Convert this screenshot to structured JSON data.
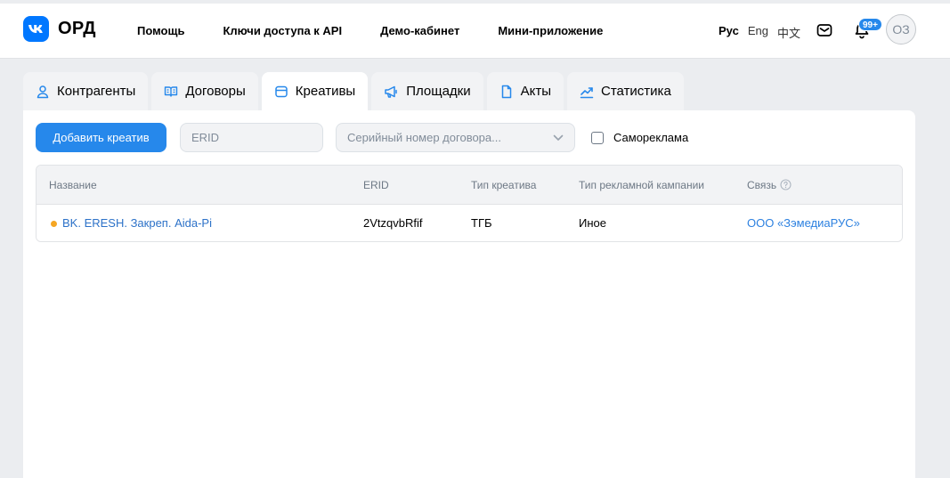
{
  "header": {
    "brand": "ОРД",
    "nav": [
      "Помощь",
      "Ключи доступа к API",
      "Демо-кабинет",
      "Мини-приложение"
    ],
    "languages": [
      "Рус",
      "Eng",
      "中文"
    ],
    "notification_badge": "99+",
    "avatar_initials": "ОЗ"
  },
  "tabs": [
    {
      "label": "Контрагенты",
      "icon": "user-icon"
    },
    {
      "label": "Договоры",
      "icon": "book-icon"
    },
    {
      "label": "Креативы",
      "icon": "creative-card-icon"
    },
    {
      "label": "Площадки",
      "icon": "megaphone-icon"
    },
    {
      "label": "Акты",
      "icon": "document-icon"
    },
    {
      "label": "Статистика",
      "icon": "chart-icon"
    }
  ],
  "active_tab": "Креативы",
  "toolbar": {
    "add_button_label": "Добавить креатив",
    "erid_placeholder": "ERID",
    "contract_placeholder": "Серийный номер договора...",
    "self_ad_label": "Самореклама"
  },
  "table": {
    "columns": [
      "Название",
      "ERID",
      "Тип креатива",
      "Тип рекламной кампании",
      "Связь"
    ],
    "rows": [
      {
        "name": "BK. ERESH. Закреп. Aida-Pi",
        "erid": "2VtzqvbRfif",
        "creative_type": "ТГБ",
        "campaign_type": "Иное",
        "link": "ООО «ЗэмедиаРУС»"
      }
    ]
  },
  "colors": {
    "accent": "#2688eb",
    "status_dot": "#f5a623",
    "link": "#2d81e0"
  }
}
